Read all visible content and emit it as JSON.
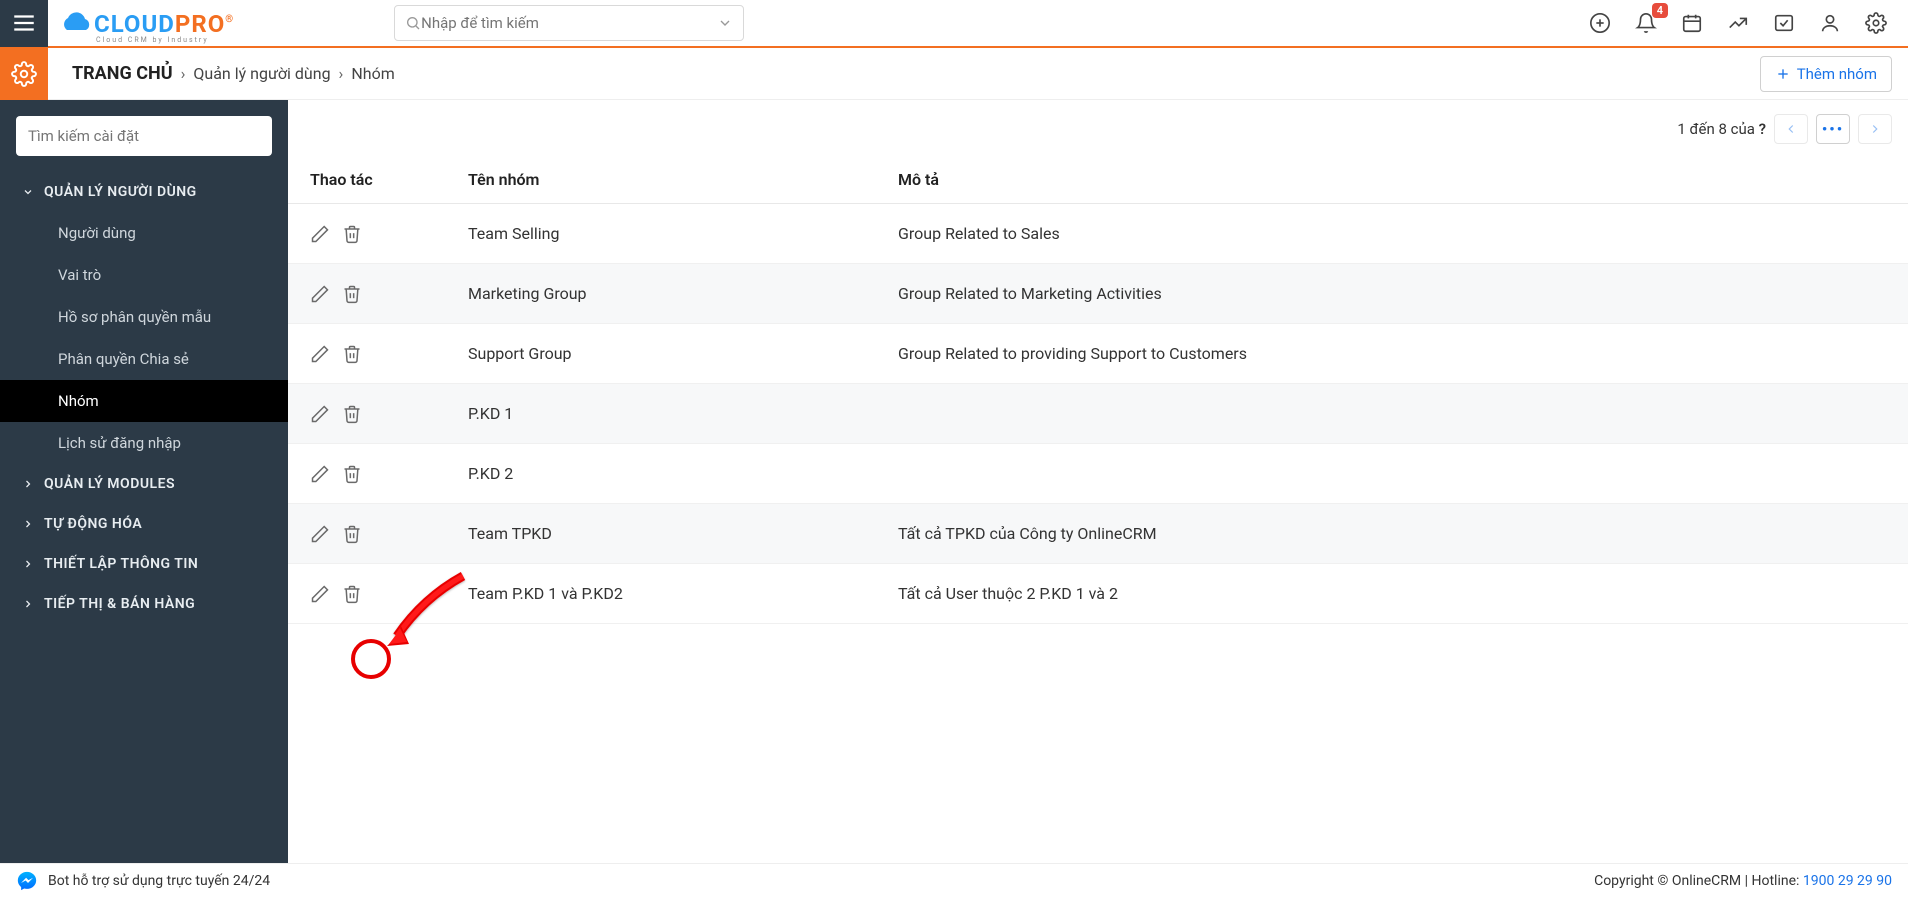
{
  "topbar": {
    "logo_cloud": "CLOUD",
    "logo_pro": "PRO",
    "logo_sub": "Cloud CRM by Industry",
    "search_placeholder": "Nhập để tìm kiếm",
    "notification_count": "4"
  },
  "breadcrumb": {
    "home": "TRANG CHỦ",
    "level1": "Quản lý người dùng",
    "level2": "Nhóm"
  },
  "actions": {
    "add_group": "Thêm nhóm"
  },
  "sidebar": {
    "search_placeholder": "Tìm kiếm cài đặt",
    "sections": [
      {
        "label": "QUẢN LÝ NGƯỜI DÙNG",
        "expanded": true,
        "items": [
          {
            "label": "Người dùng"
          },
          {
            "label": "Vai trò"
          },
          {
            "label": "Hồ sơ phân quyền mẫu"
          },
          {
            "label": "Phân quyền Chia sẻ"
          },
          {
            "label": "Nhóm",
            "active": true
          },
          {
            "label": "Lịch sử đăng nhập"
          }
        ]
      },
      {
        "label": "QUẢN LÝ MODULES",
        "expanded": false
      },
      {
        "label": "TỰ ĐỘNG HÓA",
        "expanded": false
      },
      {
        "label": "THIẾT LẬP THÔNG TIN",
        "expanded": false
      },
      {
        "label": "TIẾP THỊ & BÁN HÀNG",
        "expanded": false
      }
    ]
  },
  "pagination": {
    "text_prefix": "1 đến 8 của ",
    "total": "?"
  },
  "table": {
    "headers": {
      "actions": "Thao tác",
      "name": "Tên nhóm",
      "desc": "Mô tả"
    },
    "rows": [
      {
        "name": "Team Selling",
        "desc": "Group Related to Sales"
      },
      {
        "name": "Marketing Group",
        "desc": "Group Related to Marketing Activities"
      },
      {
        "name": "Support Group",
        "desc": "Group Related to providing Support to Customers"
      },
      {
        "name": "P.KD 1",
        "desc": ""
      },
      {
        "name": "P.KD 2",
        "desc": ""
      },
      {
        "name": "Team TPKD",
        "desc": "Tất cả TPKD của Công ty OnlineCRM"
      },
      {
        "name": "Team P.KD 1 và P.KD2",
        "desc": "Tất cả User thuộc 2 P.KD 1 và 2"
      }
    ]
  },
  "footer": {
    "bot_text": "Bot hỗ trợ sử dụng trực tuyến 24/24",
    "copyright": "Copyright © OnlineCRM",
    "hotline_label": "Hotline: ",
    "hotline_number": "1900 29 29 90"
  }
}
